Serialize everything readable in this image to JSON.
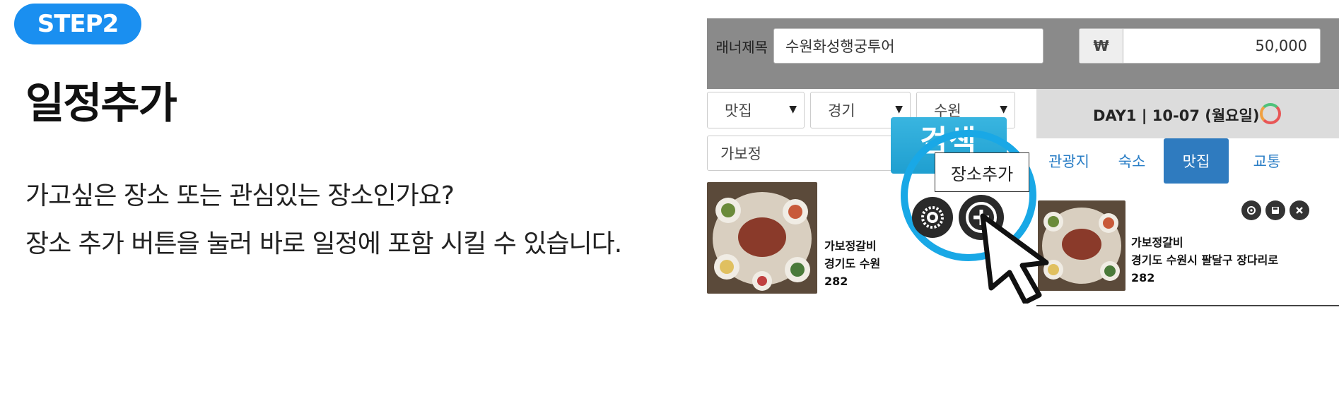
{
  "step": {
    "label": "STEP2"
  },
  "heading": {
    "title": "일정추가"
  },
  "description": {
    "line1": "가고싶은 장소 또는 관심있는 장소인가요?",
    "line2": "장소 추가 버튼을 눌러 바로 일정에 포함 시킬 수 있습니다."
  },
  "planner": {
    "title_label": "래너제목",
    "title_value": "수원화성행궁투어",
    "currency_symbol": "₩",
    "budget_value": "50,000"
  },
  "filters": {
    "category": "맛집",
    "province": "경기",
    "city": "수원",
    "arrow": "▼"
  },
  "search": {
    "query": "가보정",
    "button_label": "검색"
  },
  "left_result": {
    "name": "가보정갈비",
    "address": "경기도 수원",
    "number": "282"
  },
  "tooltip": {
    "label": "장소추가"
  },
  "day": {
    "label": "DAY1 | 10-07 (월요일)"
  },
  "tabs": [
    "관광지",
    "숙소",
    "맛집",
    "교통"
  ],
  "right_result": {
    "name": "가보정갈비",
    "address": "경기도 수원시 팔달구 장다리로",
    "number": "282"
  },
  "colors": {
    "badge": "#1a8ff0",
    "highlight_circle": "#19a8e6",
    "search_button": "#2aa9d9",
    "active_tab": "#2f7bbf",
    "topbar": "#8a8a8a"
  },
  "icons": {
    "gear": "gear-icon",
    "add": "plus-circle-icon",
    "cursor": "mouse-pointer-icon",
    "locate": "target-icon",
    "save": "save-icon",
    "close": "close-icon"
  }
}
